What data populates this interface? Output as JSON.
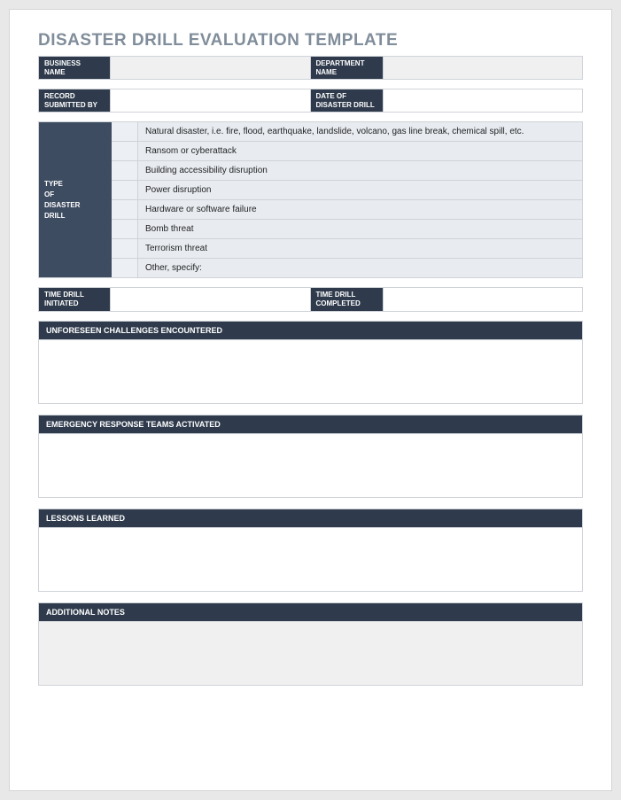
{
  "title": "DISASTER DRILL EVALUATION TEMPLATE",
  "fields": {
    "business_name_label": "BUSINESS\nNAME",
    "department_name_label": "DEPARTMENT\nNAME",
    "record_submitted_by_label": "RECORD\nSUBMITTED BY",
    "date_of_drill_label": "DATE OF\nDISASTER DRILL",
    "time_initiated_label": "TIME DRILL\nINITIATED",
    "time_completed_label": "TIME DRILL\nCOMPLETED"
  },
  "type_block": {
    "label": "TYPE\nOF\nDISASTER\nDRILL",
    "options": [
      "Natural disaster, i.e. fire, flood, earthquake, landslide, volcano, gas line break, chemical spill, etc.",
      "Ransom or cyberattack",
      "Building accessibility disruption",
      "Power disruption",
      "Hardware or software failure",
      "Bomb threat",
      "Terrorism threat",
      "Other, specify:"
    ]
  },
  "sections": {
    "challenges": "UNFORESEEN CHALLENGES ENCOUNTERED",
    "teams": "EMERGENCY RESPONSE TEAMS ACTIVATED",
    "lessons": "LESSONS LEARNED",
    "notes": "ADDITIONAL NOTES"
  }
}
